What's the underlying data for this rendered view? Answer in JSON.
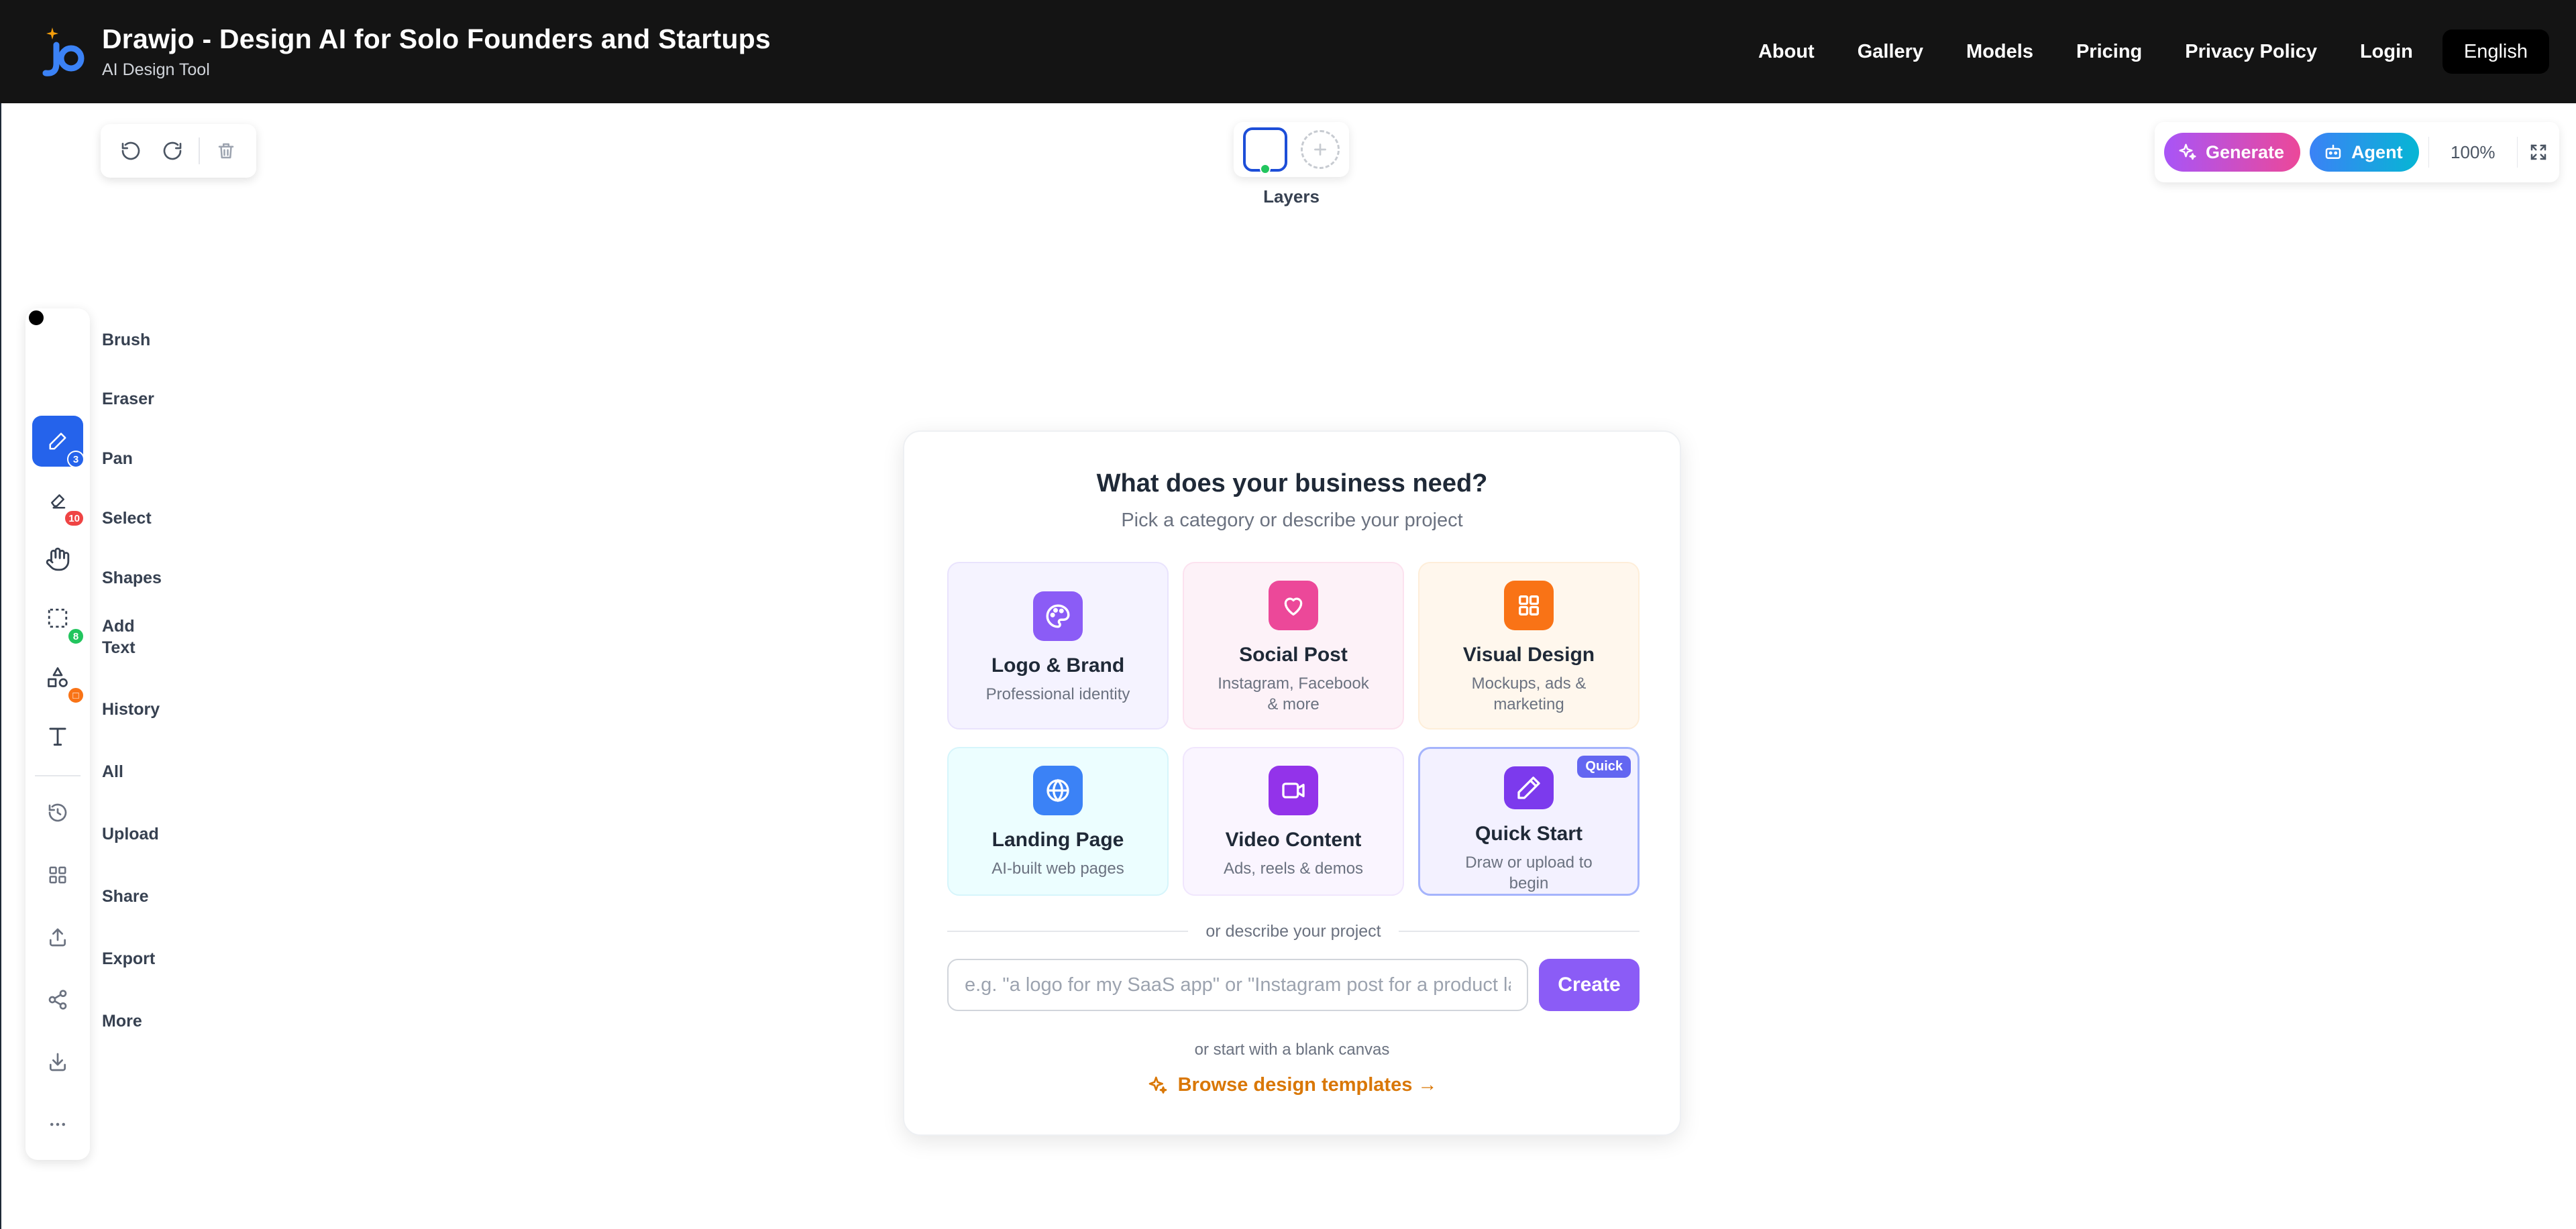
{
  "app": {
    "title": "Drawjo - Design AI for Solo Founders and Startups",
    "subtitle": "AI Design Tool"
  },
  "nav": {
    "links": [
      "About",
      "Gallery",
      "Models",
      "Pricing",
      "Privacy Policy",
      "Login"
    ],
    "language": "English"
  },
  "history_controls": {
    "icons": [
      "undo-icon",
      "redo-icon",
      "trash-icon"
    ]
  },
  "layers": {
    "label": "Layers"
  },
  "top_right": {
    "generate_label": "Generate",
    "agent_label": "Agent",
    "zoom": "100%"
  },
  "toolbar": {
    "tools": [
      {
        "label": "Brush",
        "icon": "pencil-icon",
        "badge": "3",
        "badge_color": "#2563eb",
        "active": true
      },
      {
        "label": "Eraser",
        "icon": "eraser-icon",
        "badge": "10",
        "badge_color": "#ef4444"
      },
      {
        "label": "Pan",
        "icon": "hand-icon"
      },
      {
        "label": "Select",
        "icon": "select-icon",
        "badge": "8",
        "badge_color": "#22c55e"
      },
      {
        "label": "Shapes",
        "icon": "shapes-icon",
        "badge": "□",
        "badge_color": "#f97316"
      },
      {
        "label": "Add\nText",
        "icon": "text-icon"
      },
      {
        "label": "History",
        "icon": "history-icon"
      },
      {
        "label": "All",
        "icon": "grid-icon"
      },
      {
        "label": "Upload",
        "icon": "upload-icon"
      },
      {
        "label": "Share",
        "icon": "share-icon"
      },
      {
        "label": "Export",
        "icon": "download-icon"
      },
      {
        "label": "More",
        "icon": "more-icon"
      }
    ]
  },
  "card": {
    "title": "What does your business need?",
    "subtitle": "Pick a category or describe your project",
    "categories": [
      {
        "title": "Logo & Brand",
        "desc": "Professional identity",
        "icon": "palette-icon",
        "color": "#8b5cf6"
      },
      {
        "title": "Social Post",
        "desc": "Instagram, Facebook & more",
        "icon": "heart-icon",
        "color": "#ec4899"
      },
      {
        "title": "Visual Design",
        "desc": "Mockups, ads & marketing",
        "icon": "grid-icon",
        "color": "#f97316"
      },
      {
        "title": "Landing Page",
        "desc": "AI-built web pages",
        "icon": "globe-icon",
        "color": "#3b82f6"
      },
      {
        "title": "Video Content",
        "desc": "Ads, reels & demos",
        "icon": "video-icon",
        "color": "#9333ea"
      },
      {
        "title": "Quick Start",
        "desc": "Draw or upload to begin",
        "icon": "pencil-icon",
        "color": "#7c3aed",
        "badge": "Quick"
      }
    ],
    "or_text": "or describe your project",
    "input_placeholder": "e.g. \"a logo for my SaaS app\" or \"Instagram post for a product lau",
    "create_label": "Create",
    "blank_text": "or start with a blank canvas",
    "browse_label": "Browse design templates →"
  }
}
